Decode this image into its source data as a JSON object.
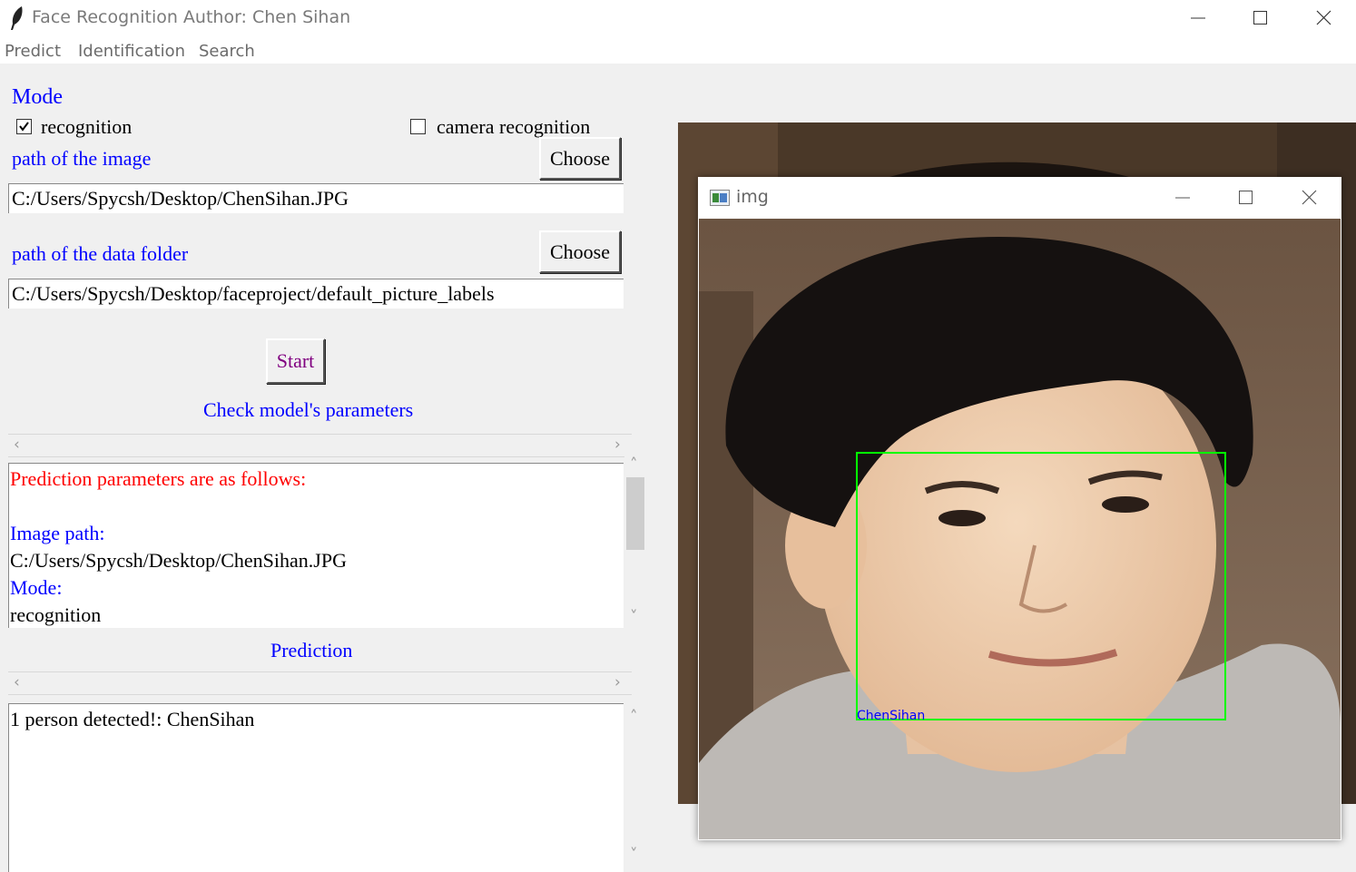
{
  "window": {
    "title": "Face Recognition Author: Chen Sihan"
  },
  "menu": [
    "Predict",
    "Identification",
    "Search"
  ],
  "mode": {
    "heading": "Mode",
    "recognition_label": "recognition",
    "recognition_checked": true,
    "camera_label": "camera recognition",
    "camera_checked": false
  },
  "image_path": {
    "label": "path of the image",
    "button": "Choose",
    "value": "C:/Users/Spycsh/Desktop/ChenSihan.JPG"
  },
  "data_folder": {
    "label": "path of the data folder",
    "button": "Choose",
    "value": "C:/Users/Spycsh/Desktop/faceproject/default_picture_labels"
  },
  "start_button": "Start",
  "params": {
    "heading": "Check model's parameters",
    "lines": [
      "Prediction parameters are as follows:",
      "",
      "Image path:",
      "C:/Users/Spycsh/Desktop/ChenSihan.JPG",
      "Mode:",
      "recognition"
    ]
  },
  "prediction": {
    "heading": "Prediction",
    "text": "1 person detected!: ChenSihan"
  },
  "img_window": {
    "title": "img",
    "face_label": "ChenSihan",
    "box_color": "#00ff00",
    "label_color": "#0000ff"
  },
  "colors": {
    "accent_blue": "#0000ff",
    "start_text": "#800080",
    "params_title": "#ff0000"
  }
}
